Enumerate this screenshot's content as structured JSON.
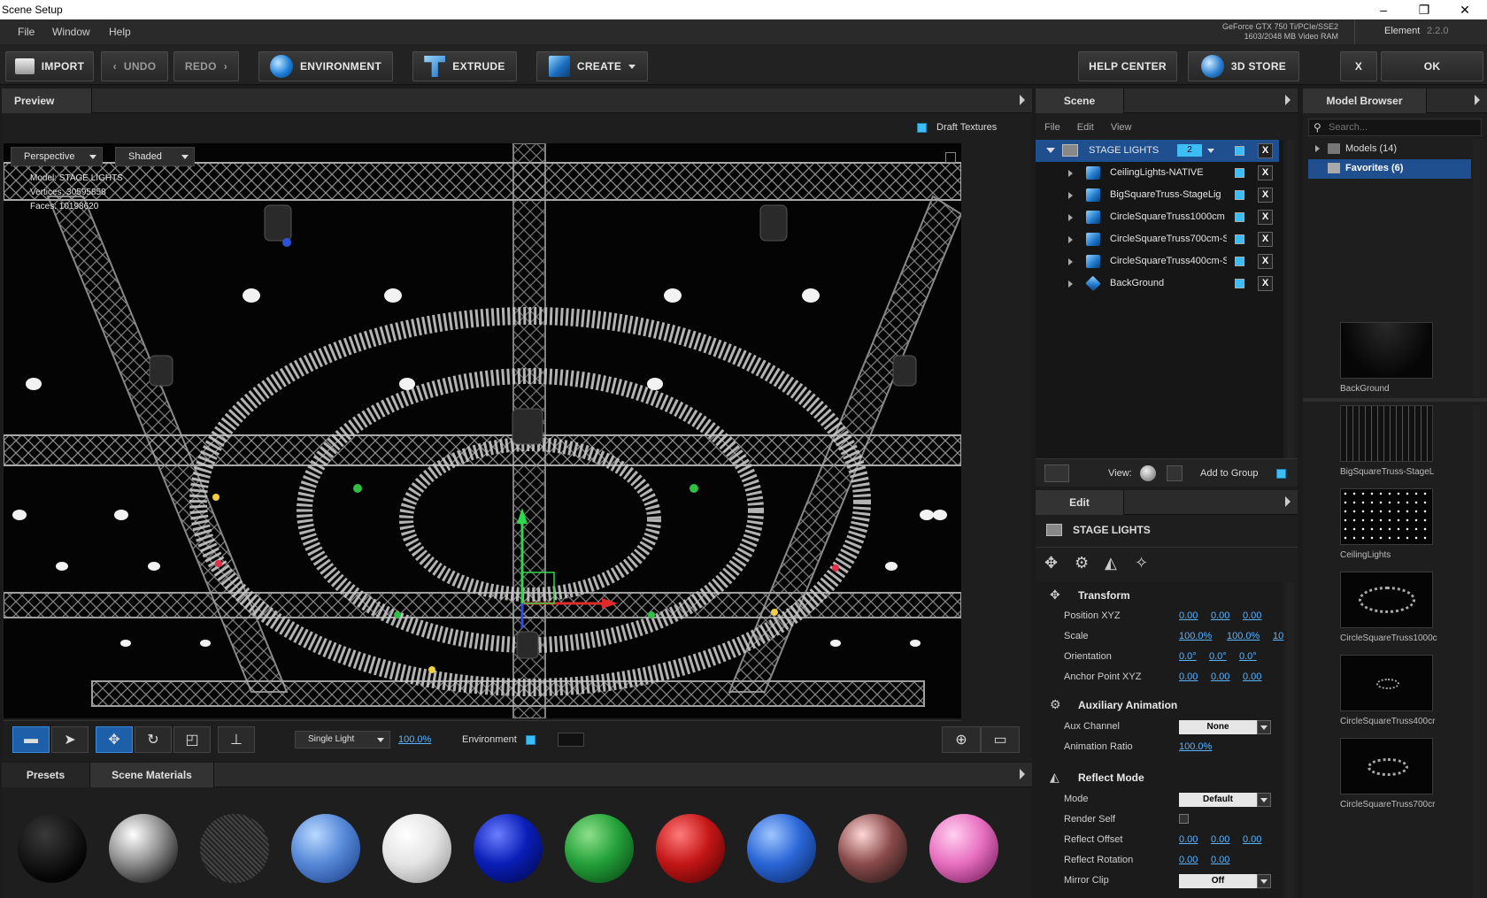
{
  "window": {
    "title": "Scene Setup",
    "minimize": "–",
    "restore": "❐",
    "close": "✕"
  },
  "menubar": {
    "items": [
      "File",
      "Window",
      "Help"
    ],
    "gpu_line1": "GeForce GTX 750 Ti/PCIe/SSE2",
    "gpu_line2": "1603/2048 MB Video RAM",
    "product": "Element",
    "version": "2.2.0"
  },
  "toolbar": {
    "import": "IMPORT",
    "undo": "UNDO",
    "redo": "REDO",
    "environment": "ENVIRONMENT",
    "extrude": "EXTRUDE",
    "create": "CREATE",
    "help_center": "HELP CENTER",
    "store": "3D STORE",
    "cancel": "X",
    "ok": "OK"
  },
  "preview": {
    "tab": "Preview",
    "draft_textures": "Draft Textures",
    "camera_mode": "Perspective",
    "shading_mode": "Shaded",
    "info": {
      "model_label": "Model:",
      "model_value": "STAGE LIGHTS",
      "vertices_label": "Vertices:",
      "vertices_value": "30595858",
      "faces_label": "Faces:",
      "faces_value": "10198620"
    },
    "light_mode": "Single Light",
    "light_pct": "100.0%",
    "environment_label": "Environment"
  },
  "scene": {
    "tab": "Scene",
    "menu": [
      "File",
      "Edit",
      "View"
    ],
    "group": {
      "name": "STAGE LIGHTS",
      "count": "2"
    },
    "items": [
      {
        "label": "CeilingLights-NATIVE"
      },
      {
        "label": "BigSquareTruss-StageLig"
      },
      {
        "label": "CircleSquareTruss1000cm"
      },
      {
        "label": "CircleSquareTruss700cm-S"
      },
      {
        "label": "CircleSquareTruss400cm-S"
      },
      {
        "label": "BackGround"
      }
    ],
    "x": "X",
    "view_label": "View:",
    "add_to_group": "Add to Group"
  },
  "edit": {
    "tab": "Edit",
    "object": "STAGE LIGHTS",
    "transform": {
      "title": "Transform",
      "position_label": "Position XYZ",
      "position": [
        "0.00",
        "0.00",
        "0.00"
      ],
      "scale_label": "Scale",
      "scale": [
        "100.0%",
        "100.0%",
        "10"
      ],
      "orientation_label": "Orientation",
      "orientation": [
        "0.0°",
        "0.0°",
        "0.0°"
      ],
      "anchor_label": "Anchor Point XYZ",
      "anchor": [
        "0.00",
        "0.00",
        "0.00"
      ]
    },
    "aux": {
      "title": "Auxiliary Animation",
      "channel_label": "Aux Channel",
      "channel_value": "None",
      "ratio_label": "Animation Ratio",
      "ratio_value": "100.0%"
    },
    "reflect": {
      "title": "Reflect Mode",
      "mode_label": "Mode",
      "mode_value": "Default",
      "render_self_label": "Render Self",
      "offset_label": "Reflect Offset",
      "offset": [
        "0.00",
        "0.00",
        "0.00"
      ],
      "rotation_label": "Reflect Rotation",
      "rotation": [
        "0.00",
        "0.00"
      ],
      "mirror_label": "Mirror Clip",
      "mirror_value": "Off"
    }
  },
  "model_browser": {
    "tab": "Model Browser",
    "search_placeholder": "Search...",
    "models": "Models (14)",
    "favorites": "Favorites (6)",
    "thumbs": [
      {
        "label": "BackGround"
      },
      {
        "label": "BigSquareTruss-StageL"
      },
      {
        "label": "CeilingLights"
      },
      {
        "label": "CircleSquareTruss1000c"
      },
      {
        "label": "CircleSquareTruss400cr"
      },
      {
        "label": "CircleSquareTruss700cr"
      }
    ]
  },
  "bottom": {
    "presets_tab": "Presets",
    "materials_tab": "Scene Materials"
  },
  "colors": {
    "accent": "#3dbdf5",
    "selection": "#1f4f8f",
    "link": "#5ab4ff"
  }
}
